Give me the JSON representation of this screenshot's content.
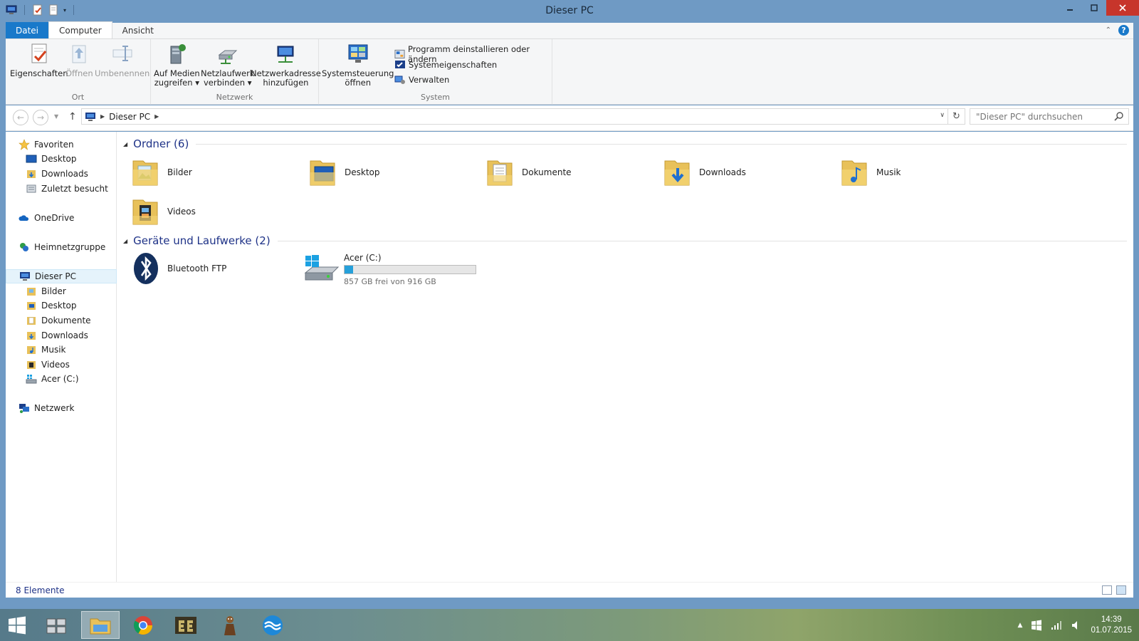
{
  "window": {
    "title": "Dieser PC"
  },
  "ribbon": {
    "tabs": [
      {
        "label": "Datei"
      },
      {
        "label": "Computer"
      },
      {
        "label": "Ansicht"
      }
    ],
    "groups": {
      "ort": {
        "label": "Ort",
        "buttons": [
          {
            "label": "Eigenschaften",
            "enabled": true
          },
          {
            "label": "Öffnen",
            "enabled": false
          },
          {
            "label": "Umbenennen",
            "enabled": false
          }
        ]
      },
      "netzwerk": {
        "label": "Netzwerk",
        "buttons": [
          {
            "line1": "Auf Medien",
            "line2": "zugreifen ▾"
          },
          {
            "line1": "Netzlaufwerk",
            "line2": "verbinden ▾"
          },
          {
            "line1": "Netzwerkadresse",
            "line2": "hinzufügen"
          }
        ]
      },
      "system": {
        "label": "System",
        "big_button": {
          "line1": "Systemsteuerung",
          "line2": "öffnen"
        },
        "small_buttons": [
          {
            "label": "Programm deinstallieren oder ändern"
          },
          {
            "label": "Systemeigenschaften"
          },
          {
            "label": "Verwalten"
          }
        ]
      }
    }
  },
  "address": {
    "path": "Dieser PC",
    "search_placeholder": "\"Dieser PC\" durchsuchen"
  },
  "nav": {
    "items": [
      {
        "label": "Favoriten",
        "icon": "star-icon"
      },
      {
        "label": "Desktop",
        "icon": "desktop-icon"
      },
      {
        "label": "Downloads",
        "icon": "downloads-folder-icon"
      },
      {
        "label": "Zuletzt besucht",
        "icon": "recent-places-icon"
      },
      {
        "label": "OneDrive",
        "icon": "onedrive-icon"
      },
      {
        "label": "Heimnetzgruppe",
        "icon": "homegroup-icon"
      },
      {
        "label": "Dieser PC",
        "icon": "computer-icon"
      },
      {
        "label": "Bilder",
        "icon": "pictures-folder-icon"
      },
      {
        "label": "Desktop",
        "icon": "desktop-folder-icon"
      },
      {
        "label": "Dokumente",
        "icon": "documents-folder-icon"
      },
      {
        "label": "Downloads",
        "icon": "downloads-folder-icon"
      },
      {
        "label": "Musik",
        "icon": "music-folder-icon"
      },
      {
        "label": "Videos",
        "icon": "videos-folder-icon"
      },
      {
        "label": "Acer (C:)",
        "icon": "drive-icon"
      },
      {
        "label": "Netzwerk",
        "icon": "network-icon"
      }
    ]
  },
  "content": {
    "folders_header": "Ordner (6)",
    "folders": [
      {
        "label": "Bilder",
        "icon": "pictures-folder-icon"
      },
      {
        "label": "Desktop",
        "icon": "desktop-folder-icon"
      },
      {
        "label": "Dokumente",
        "icon": "documents-folder-icon"
      },
      {
        "label": "Downloads",
        "icon": "downloads-folder-icon"
      },
      {
        "label": "Musik",
        "icon": "music-folder-icon"
      },
      {
        "label": "Videos",
        "icon": "videos-folder-icon"
      }
    ],
    "devices_header": "Geräte und Laufwerke (2)",
    "bluetooth": {
      "label": "Bluetooth FTP",
      "icon": "bluetooth-icon"
    },
    "drive": {
      "name": "Acer (C:)",
      "free_text": "857 GB frei von 916 GB",
      "used_fraction": 0.0644
    }
  },
  "status": {
    "items_count": "8 Elemente"
  },
  "taskbar": {
    "time": "14:39",
    "date": "01.07.2015",
    "apps": [
      "start-icon",
      "virtual-desktops-icon",
      "file-explorer-icon",
      "chrome-icon",
      "game-icon",
      "character-icon",
      "app-wave-icon"
    ]
  },
  "colors": {
    "accent": "#1979ca",
    "window_frame": "#6f9ac4",
    "close_button": "#c7352b",
    "drive_fill": "#26a0da",
    "group_header": "#1e3287",
    "folder": "#e8c15a"
  }
}
